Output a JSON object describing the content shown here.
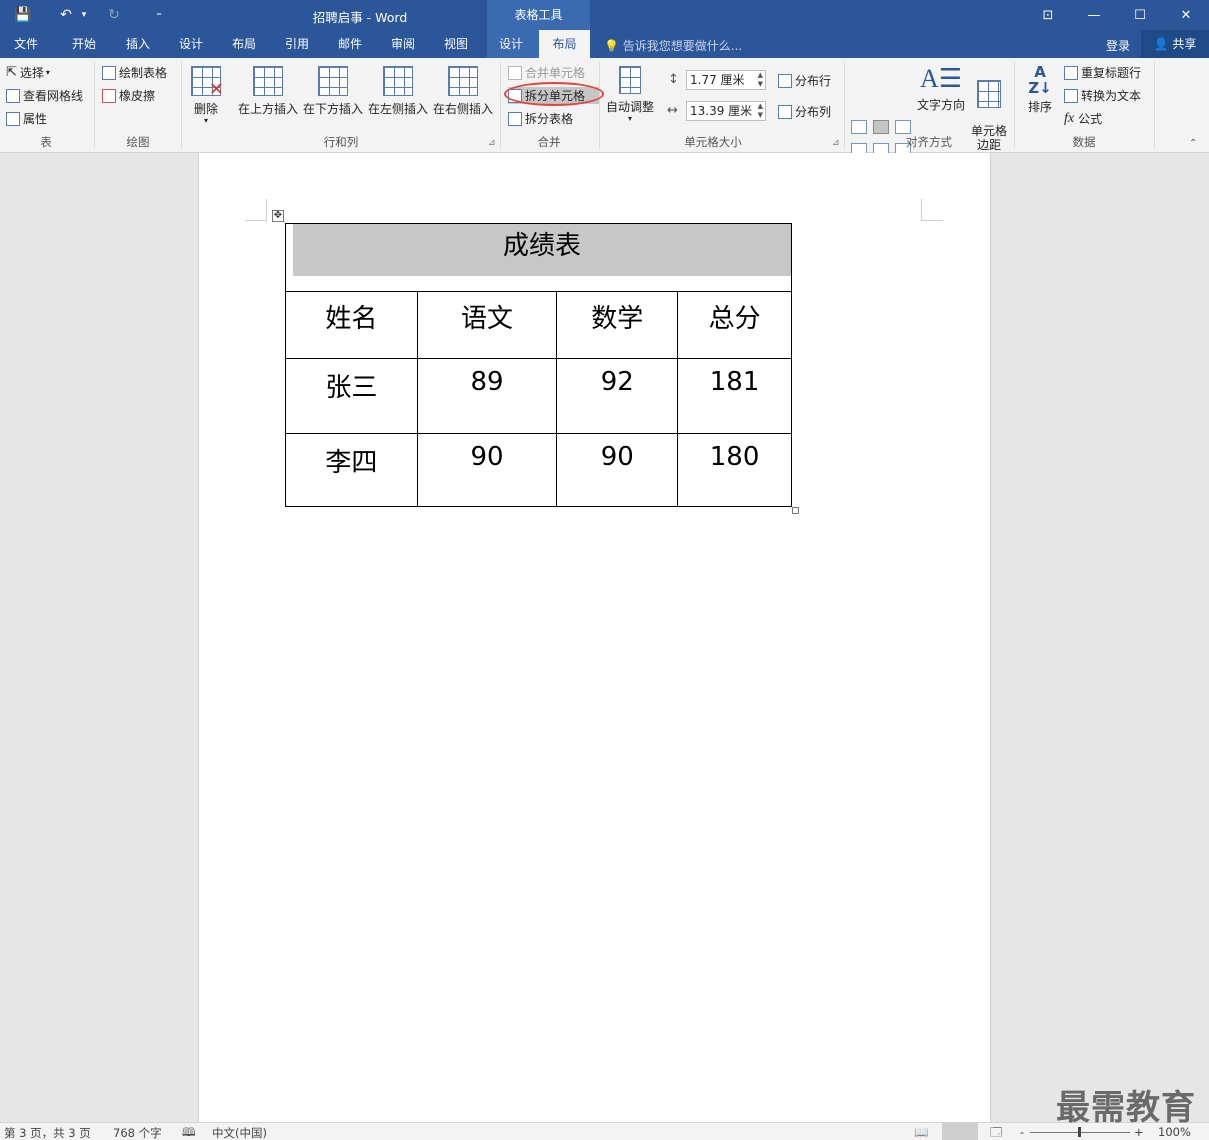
{
  "titlebar": {
    "doc_title": "招聘启事 - Word",
    "context_tab_group": "表格工具",
    "quick_access": {
      "save": "💾",
      "undo": "↶",
      "undo_drop": "▾",
      "redo": "↻",
      "customize": "⁼"
    },
    "window_controls": {
      "ribbon_options": "⊡",
      "minimize": "—",
      "maximize": "☐",
      "close": "✕"
    }
  },
  "tabs": [
    {
      "label": "文件"
    },
    {
      "label": "开始"
    },
    {
      "label": "插入"
    },
    {
      "label": "设计"
    },
    {
      "label": "布局"
    },
    {
      "label": "引用"
    },
    {
      "label": "邮件"
    },
    {
      "label": "审阅"
    },
    {
      "label": "视图"
    },
    {
      "label": "设计"
    },
    {
      "label": "布局"
    }
  ],
  "tell_me": "告诉我您想要做什么...",
  "login": "登录",
  "share": "共享",
  "ribbon": {
    "table": {
      "label": "表",
      "select": "选择",
      "select_drop": "▾",
      "view_gridlines": "查看网格线",
      "properties": "属性"
    },
    "draw": {
      "label": "绘图",
      "draw_table": "绘制表格",
      "eraser": "橡皮擦"
    },
    "rows_cols": {
      "label": "行和列",
      "delete": "删除",
      "delete_drop": "▾",
      "insert_above": "在上方插入",
      "insert_below": "在下方插入",
      "insert_left": "在左侧插入",
      "insert_right": "在右侧插入",
      "launcher": "⊿"
    },
    "merge": {
      "label": "合并",
      "merge_cells": "合并单元格",
      "split_cells": "拆分单元格",
      "split_table": "拆分表格"
    },
    "cell_size": {
      "label": "单元格大小",
      "autofit": "自动调整",
      "autofit_drop": "▾",
      "height": "1.77 厘米",
      "width": "13.39 厘米",
      "distribute_rows": "分布行",
      "distribute_cols": "分布列",
      "launcher": "⊿"
    },
    "alignment": {
      "label": "对齐方式",
      "text_direction": "文字方向",
      "cell_margins": "单元格\n边距"
    },
    "data": {
      "label": "数据",
      "sort": "排序",
      "repeat_header": "重复标题行",
      "convert_to_text": "转换为文本",
      "formula": "公式",
      "fx": "fx"
    },
    "collapse": "⌃"
  },
  "table": {
    "title": "成绩表",
    "headers": [
      "姓名",
      "语文",
      "数学",
      "总分"
    ],
    "rows": [
      [
        "张三",
        "89",
        "92",
        "181"
      ],
      [
        "李四",
        "90",
        "90",
        "180"
      ]
    ]
  },
  "move_handle": "✥",
  "statusbar": {
    "page": "第 3 页，共 3 页",
    "words": "768 个字",
    "proof": "🕮",
    "language": "中文(中国)",
    "zoom": "100%",
    "zoom_minus": "-",
    "zoom_plus": "+"
  },
  "watermark": "最需教育"
}
